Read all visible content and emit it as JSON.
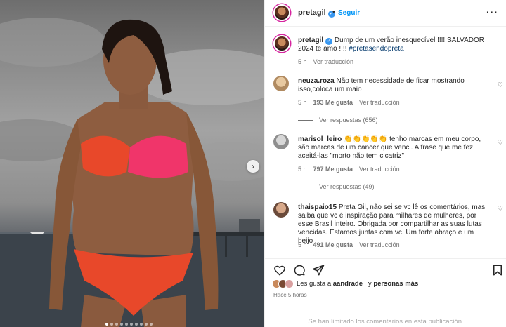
{
  "post": {
    "username": "pretagil",
    "follow_label": "Seguir",
    "separator": "•",
    "caption_text": "Dump de um verão inesquecível !!!! SALVADOR 2024 te amo !!!! ",
    "caption_hashtag": "#pretasendopreta",
    "caption_time": "5 h",
    "see_translation": "Ver traducción"
  },
  "comments": [
    {
      "username": "neuza.roza",
      "text": "Não tem necessidade de ficar mostrando isso,coloca um maio",
      "time": "5 h",
      "likes": "193 Me gusta",
      "translate": "Ver traducción",
      "replies": "Ver respuestas (656)"
    },
    {
      "username": "marisol_leiro",
      "emojis": "👏👏👏👏👏",
      "text": "tenho marcas em meu corpo, são marcas de um cancer que venci. A frase que me fez aceitá-las \"morto não tem cicatriz\"",
      "time": "5 h",
      "likes": "797 Me gusta",
      "translate": "Ver traducción",
      "replies": "Ver respuestas (49)"
    },
    {
      "username": "thaispaio15",
      "text": "Preta Gil, não sei se vc lê os comentários, mas saiba que vc é inspiração para milhares de mulheres, por esse Brasil inteiro. Obrigada por compartilhar as suas lutas vencidas. Estamos juntas com vc. Um forte abraço e um beijo",
      "time": "5 h",
      "likes": "491 Me gusta",
      "translate": "Ver traducción"
    }
  ],
  "likes_summary": {
    "prefix": "Les gusta a ",
    "user": "aandrade_",
    "middle": " y ",
    "others": "personas más"
  },
  "time_ago": "Hace 5 horas",
  "footer_text": "Se han limitado los comentarios en esta publicación.",
  "colors": {
    "accent": "#0095f6",
    "verified": "#3897f0",
    "swimsuit_orange": "#e8482a",
    "swimsuit_pink": "#f0356a"
  },
  "icons": [
    "verified-icon",
    "more-icon",
    "heart-icon",
    "comment-icon",
    "share-icon",
    "bookmark-icon",
    "chevron-right-icon"
  ]
}
